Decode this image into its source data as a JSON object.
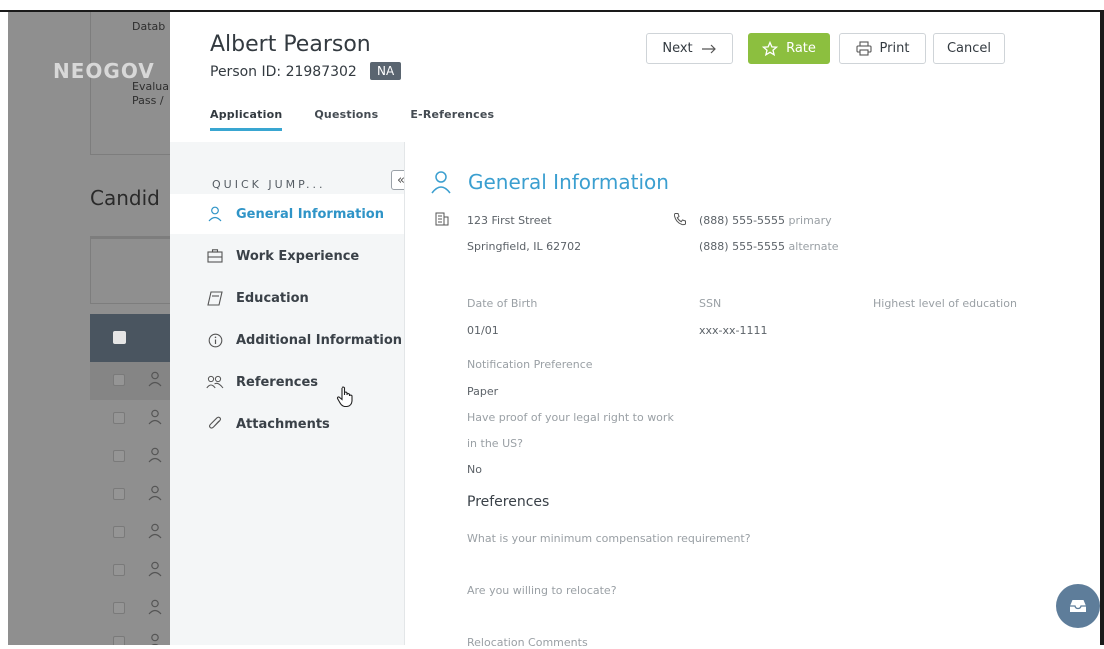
{
  "background": {
    "logo_text": "NEOGOV",
    "card_lines": [
      "Datab",
      "Evalua",
      "Pass /"
    ],
    "candidates_heading": "Candid"
  },
  "header": {
    "name": "Albert Pearson",
    "person_id": "Person ID: 21987302",
    "badge": "NA",
    "buttons": {
      "next": "Next",
      "rate": "Rate",
      "print": "Print",
      "cancel": "Cancel"
    },
    "accent": "#8cbf3f"
  },
  "tabs": [
    "Application",
    "Questions",
    "E-References"
  ],
  "sidebar": {
    "quick_jump": "QUICK JUMP...",
    "items": [
      {
        "label": "General Information",
        "icon": "user-icon",
        "active": true
      },
      {
        "label": "Work Experience",
        "icon": "briefcase-icon",
        "active": false
      },
      {
        "label": "Education",
        "icon": "book-icon",
        "active": false
      },
      {
        "label": "Additional Information",
        "icon": "info-icon",
        "active": false
      },
      {
        "label": "References",
        "icon": "users-icon",
        "active": false
      },
      {
        "label": "Attachments",
        "icon": "paperclip-icon",
        "active": false
      }
    ]
  },
  "general": {
    "title": "General Information",
    "address_line1": "123 First Street",
    "address_line2": "Springfield, IL 62702",
    "phone1": "(888) 555-5555",
    "phone1_type": "primary",
    "phone2": "(888) 555-5555",
    "phone2_type": "alternate",
    "dob_label": "Date of Birth",
    "dob_value": "01/01",
    "ssn_label": "SSN",
    "ssn_value": "xxx-xx-1111",
    "education_label": "Highest level of education",
    "notification_label": "Notification Preference",
    "notification_value": "Paper",
    "legal_label_1": "Have proof of your legal right to work",
    "legal_label_2": "in the US?",
    "legal_value": "No"
  },
  "preferences": {
    "title": "Preferences",
    "q1": "What is your minimum compensation requirement?",
    "q2": "Are you willing to relocate?",
    "q3": "Relocation Comments"
  },
  "colors": {
    "active_link": "#2f94c7",
    "title": "#3b9fd0",
    "tab_underline": "#39a6d1"
  }
}
